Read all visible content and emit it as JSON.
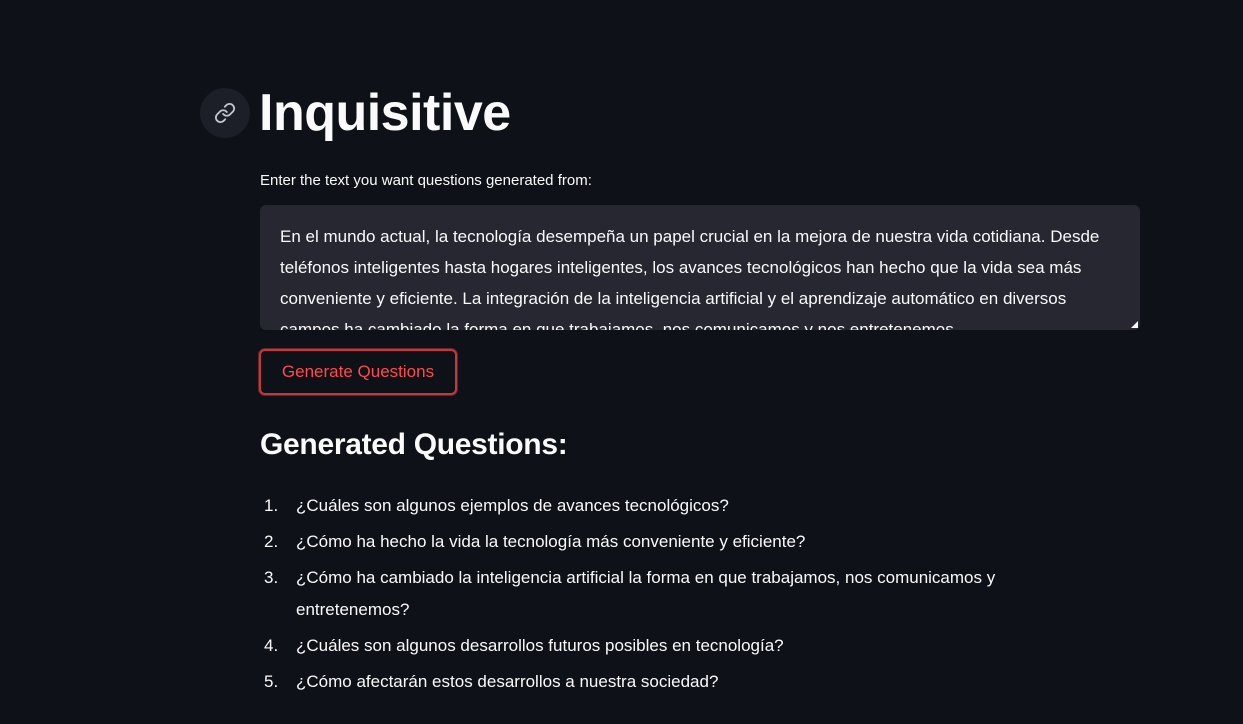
{
  "header": {
    "title": "Inquisitive",
    "anchor_icon": "link-icon"
  },
  "form": {
    "label": "Enter the text you want questions generated from:",
    "text_value": "En el mundo actual, la tecnología desempeña un papel crucial en la mejora de nuestra vida cotidiana. Desde teléfonos inteligentes hasta hogares inteligentes, los avances tecnológicos han hecho que la vida sea más conveniente y eficiente. La integración de la inteligencia artificial y el aprendizaje automático en diversos campos ha cambiado la forma en que trabajamos, nos comunicamos y nos entretenemos.",
    "button_label": "Generate Questions"
  },
  "results": {
    "heading": "Generated Questions:",
    "questions": [
      {
        "num": "1.",
        "text": "¿Cuáles son algunos ejemplos de avances tecnológicos?"
      },
      {
        "num": "2.",
        "text": "¿Cómo ha hecho la vida la tecnología más conveniente y eficiente?"
      },
      {
        "num": "3.",
        "text": "¿Cómo ha cambiado la inteligencia artificial la forma en que trabajamos, nos comunicamos y entretenemos?"
      },
      {
        "num": "4.",
        "text": "¿Cuáles son algunos desarrollos futuros posibles en tecnología?"
      },
      {
        "num": "5.",
        "text": "¿Cómo afectarán estos desarrollos a nuestra sociedad?"
      }
    ]
  },
  "colors": {
    "background": "#0e1117",
    "input_bg": "#262730",
    "accent": "#ff4b4b",
    "text": "#fafafa"
  }
}
